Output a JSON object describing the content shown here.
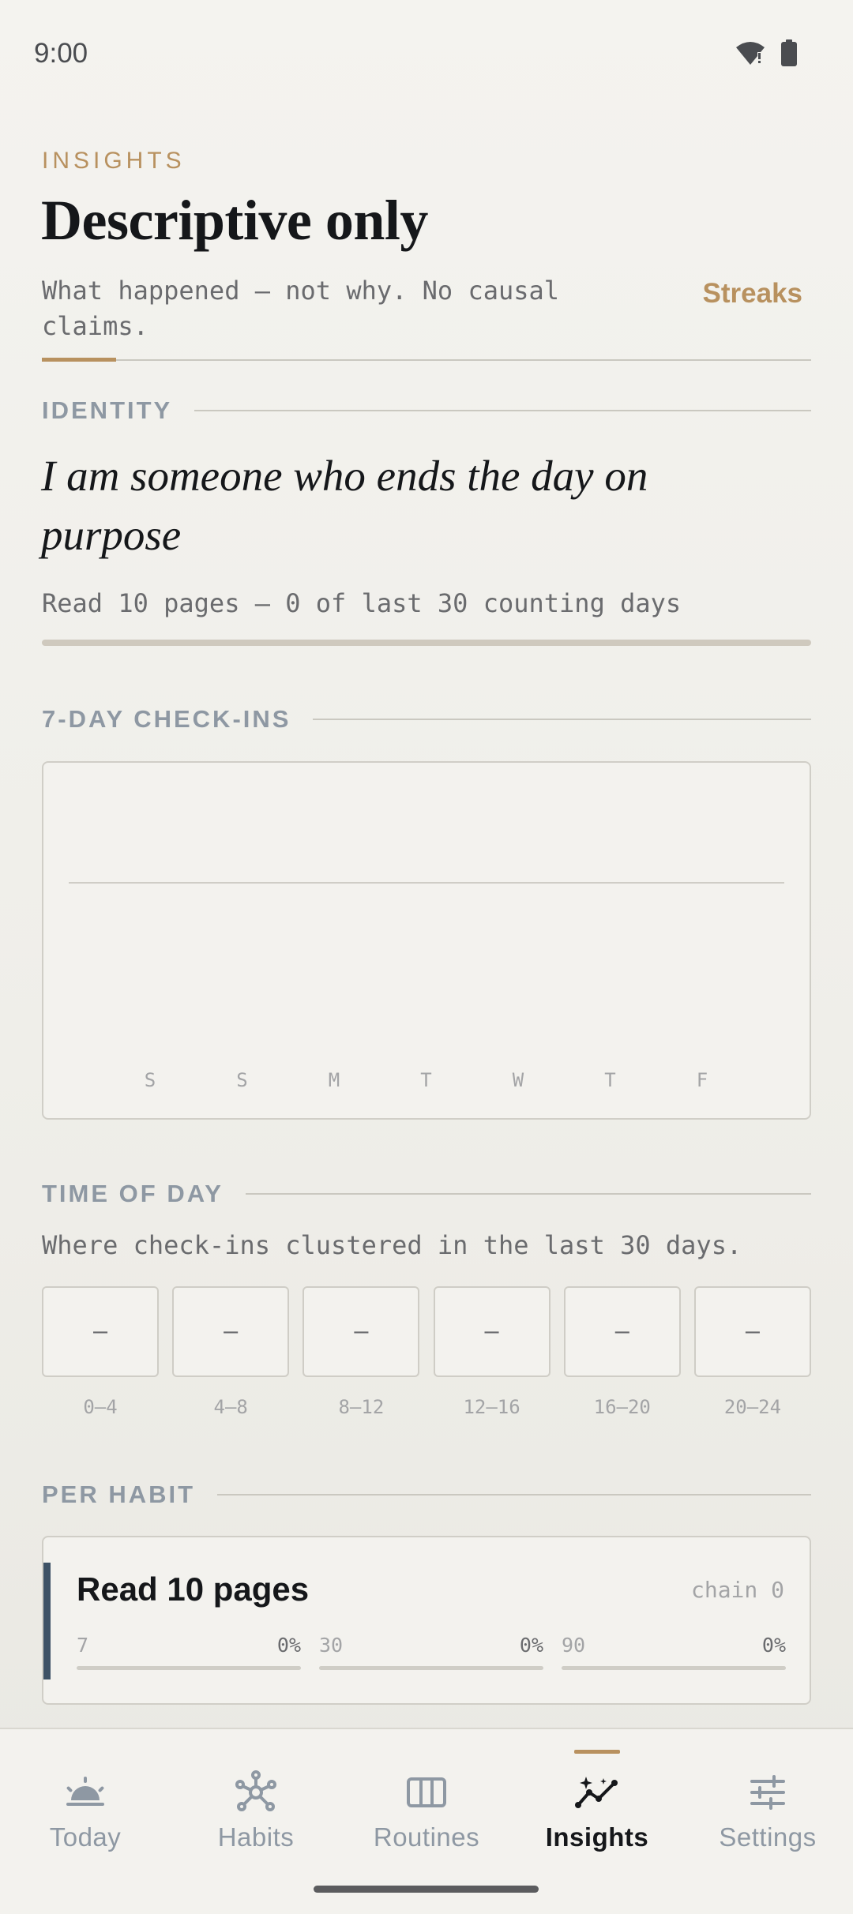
{
  "status_bar": {
    "time": "9:00",
    "icons": [
      "wifi-alert-icon",
      "battery-icon"
    ]
  },
  "header": {
    "eyebrow": "INSIGHTS",
    "title": "Descriptive only",
    "subtitle": "What happened — not why. No causal claims.",
    "streaks_link": "Streaks"
  },
  "identity": {
    "section_label": "IDENTITY",
    "statement": "I am someone who ends the day on purpose",
    "progress_text": "Read 10 pages — 0 of last 30 counting days",
    "progress": 0
  },
  "checkins": {
    "section_label": "7-DAY CHECK-INS"
  },
  "chart_data": {
    "type": "bar",
    "title": "7-DAY CHECK-INS",
    "categories": [
      "S",
      "S",
      "M",
      "T",
      "W",
      "T",
      "F"
    ],
    "values": [
      0,
      0,
      0,
      0,
      0,
      0,
      0
    ],
    "xlabel": "",
    "ylabel": "",
    "grid": true
  },
  "time_of_day": {
    "section_label": "TIME OF DAY",
    "caption": "Where check-ins clustered in the last 30 days.",
    "buckets": [
      {
        "range": "0–4",
        "value": "–"
      },
      {
        "range": "4–8",
        "value": "–"
      },
      {
        "range": "8–12",
        "value": "–"
      },
      {
        "range": "12–16",
        "value": "–"
      },
      {
        "range": "16–20",
        "value": "–"
      },
      {
        "range": "20–24",
        "value": "–"
      }
    ]
  },
  "per_habit": {
    "section_label": "PER HABIT",
    "habits": [
      {
        "name": "Read 10 pages",
        "chain": "chain 0",
        "color": "#3e5266",
        "windows": [
          {
            "days": "7",
            "percent": "0%",
            "value": 0
          },
          {
            "days": "30",
            "percent": "0%",
            "value": 0
          },
          {
            "days": "90",
            "percent": "0%",
            "value": 0
          }
        ]
      }
    ]
  },
  "nav": {
    "items": [
      {
        "label": "Today",
        "icon": "sunrise-icon"
      },
      {
        "label": "Habits",
        "icon": "molecule-icon"
      },
      {
        "label": "Routines",
        "icon": "columns-icon"
      },
      {
        "label": "Insights",
        "icon": "insights-chart-icon"
      },
      {
        "label": "Settings",
        "icon": "sliders-icon"
      }
    ],
    "active": "Insights"
  },
  "colors": {
    "accent": "#b8915f",
    "text": "#15171a",
    "muted": "#8e98a3",
    "habit": "#3e5266"
  }
}
